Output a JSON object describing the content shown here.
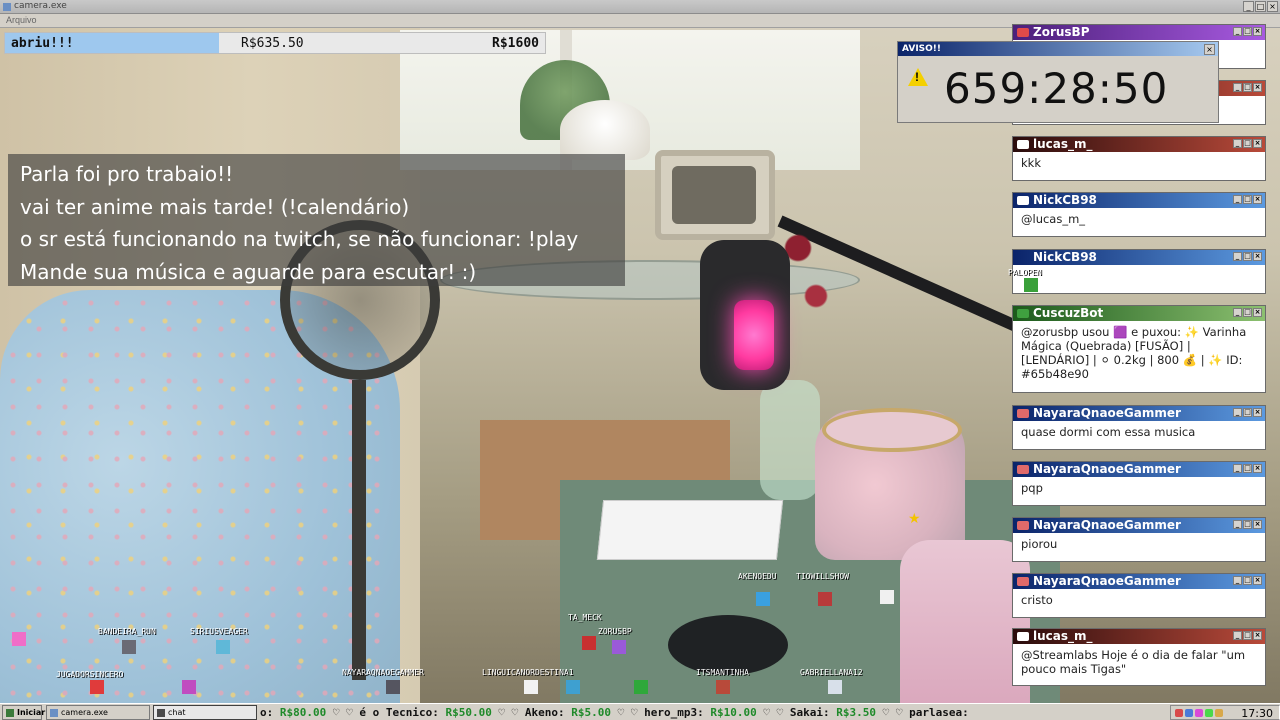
{
  "window": {
    "title": "camera.exe",
    "menu_item": "Arquivo"
  },
  "goal": {
    "label": "abriu!!!",
    "current": "R$635.50",
    "target": "R$1600",
    "progress": 0.397
  },
  "info_lines": [
    "Parla foi pro trabaio!!",
    "vai ter anime mais tarde! (!calendário)",
    "o sr está funcionando na twitch, se não funcionar: !play",
    "Mande sua música e aguarde para escutar! :)"
  ],
  "warning": {
    "title": "AVISO!!",
    "timer": "659:28:50"
  },
  "chat": [
    {
      "user": "ZorusBP",
      "message": "",
      "color": "purple"
    },
    {
      "user": "",
      "message": "",
      "color": "red"
    },
    {
      "user": "lucas_m_",
      "message": "kkk",
      "color": "red"
    },
    {
      "user": "NickCB98",
      "message": "@lucas_m_",
      "color": "blue"
    },
    {
      "user": "NickCB98",
      "message": "",
      "color": "blue"
    },
    {
      "user": "CuscuzBot",
      "message": "@zorusbp usou 🟪 e puxou: ✨ Varinha Mágica (Quebrada) [FUSÃO] | [LENDÁRIO] | ⚪ 0.2kg | 800 💰 | ✨ ID: #65b48e90",
      "color": "green"
    },
    {
      "user": "NayaraQnaoeGammer",
      "message": "quase dormi com essa musica",
      "color": "blue"
    },
    {
      "user": "NayaraQnaoeGammer",
      "message": "pqp",
      "color": "blue"
    },
    {
      "user": "NayaraQnaoeGammer",
      "message": "piorou",
      "color": "blue"
    },
    {
      "user": "NayaraQnaoeGammer",
      "message": "cristo",
      "color": "blue"
    },
    {
      "user": "lucas_m_",
      "message": "@Streamlabs Hoje é o dia de falar \"um pouco mais Tigas\"",
      "color": "red"
    }
  ],
  "avatars": [
    {
      "name": "BANDEIRA_RUN"
    },
    {
      "name": "SIRIUSVEAGER"
    },
    {
      "name": "JUGADORSINCERO"
    },
    {
      "name": "NAYARAQNAOEGAMMER"
    },
    {
      "name": "LINGUICANORDESTINA1"
    },
    {
      "name": "ITSMANTINHA"
    },
    {
      "name": "GABRIELLANA12"
    },
    {
      "name": "TA_MECK"
    },
    {
      "name": "ZORUSBP"
    },
    {
      "name": "AKENOEDU"
    },
    {
      "name": "TIOWILLSHOW"
    },
    {
      "name": "PALOPEN"
    }
  ],
  "taskbar": {
    "start_label": "Iniciar",
    "buttons": [
      "camera.exe",
      "chat"
    ],
    "ticker": [
      {
        "text": "o: ",
        "amount": "R$80.00"
      },
      {
        "text": " ♡  ♡ é o Tecnico: ",
        "amount": "R$50.00"
      },
      {
        "text": " ♡  ♡ Akeno: ",
        "amount": "R$5.00"
      },
      {
        "text": " ♡  ♡ hero_mp3: ",
        "amount": "R$10.00"
      },
      {
        "text": " ♡  ♡ Sakai: ",
        "amount": "R$3.50"
      },
      {
        "text": " ♡  ♡ parlasea:",
        "amount": ""
      }
    ],
    "clock": "17:30"
  }
}
